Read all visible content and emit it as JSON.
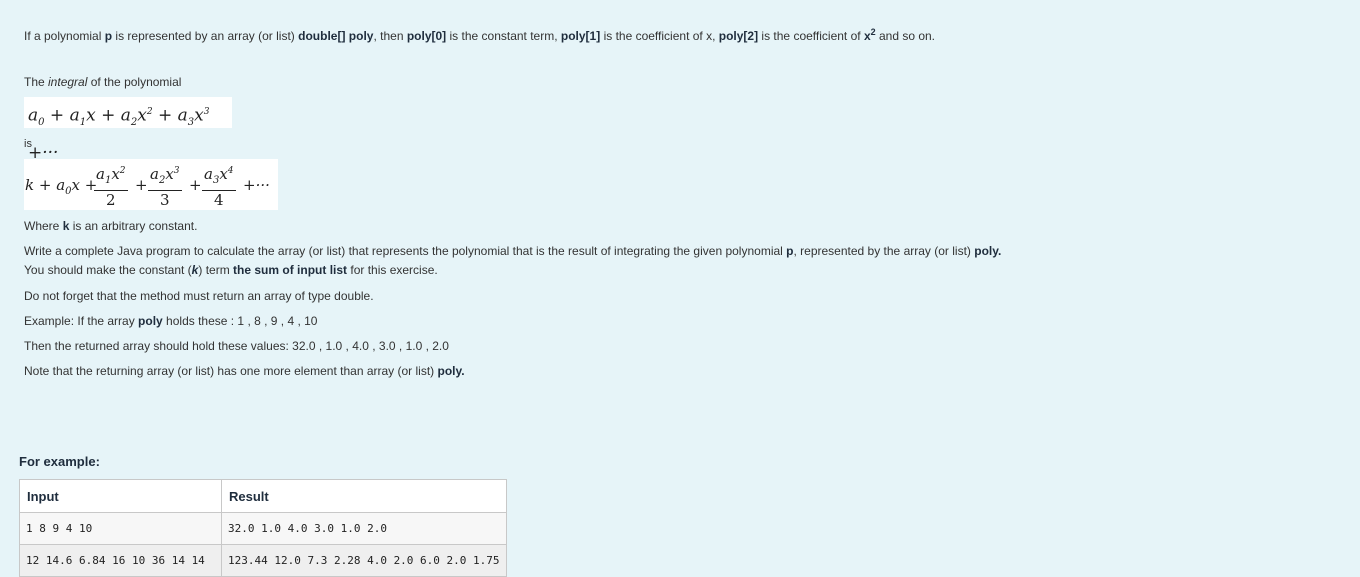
{
  "intro": {
    "t1": "If a polynomial ",
    "b1": "p",
    "t2": " is represented by an array (or list) ",
    "b2": "double[] poly",
    "t3": ", then ",
    "b3": "poly[0]",
    "t4": " is the constant term, ",
    "b4": "poly[1]",
    "t5": " is the coefficient of x, ",
    "b5": "poly[2]",
    "t6": " is the coefficient of ",
    "b6": "x",
    "b6sup": "2",
    "t7": " and so on."
  },
  "integral_line": {
    "t1": "The ",
    "em": "integral",
    "t2": " of the polynomial"
  },
  "is_label": "is",
  "where_line": {
    "t1": "Where ",
    "b1": "k",
    "t2": " is an arbitrary constant."
  },
  "task": {
    "t1": "Write a complete Java program to calculate the array (or list) that represents the polynomial that is the result of integrating the given polynomial ",
    "b1": "p",
    "t2": ", represented by the array (or list) ",
    "b2": "poly.",
    "t3": " You should make the constant (",
    "b3": "k",
    "t4": ") term ",
    "b4": "the sum of input list",
    "t5": " for this exercise."
  },
  "return_note": "Do not forget that the method must return an array of type double.",
  "example_line": {
    "t1": "Example: If the array ",
    "b1": "poly",
    "t2": " holds these :  1 , 8 , 9 , 4 , 10"
  },
  "returned_line": "Then the returned array should hold these values: 32.0 , 1.0 , 4.0 , 3.0 , 1.0 , 2.0",
  "note_line": {
    "t1": "Note that the returning array (or list) has one more element than array (or list) ",
    "b1": "poly."
  },
  "examples": {
    "title": "For example:",
    "headers": [
      "Input",
      "Result"
    ],
    "rows": [
      [
        "1 8 9 4 10",
        "32.0 1.0 4.0 3.0 1.0 2.0"
      ],
      [
        "12 14.6 6.84 16 10 36 14 14",
        "123.44 12.0 7.3 2.28 4.0 2.0 6.0 2.0 1.75"
      ]
    ]
  }
}
